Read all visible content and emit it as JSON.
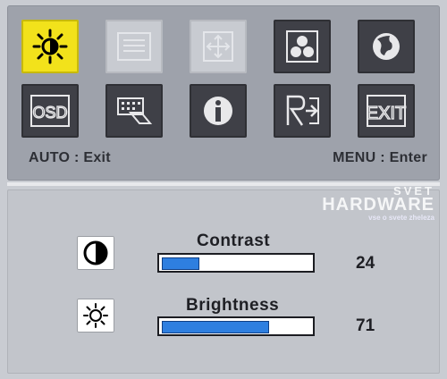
{
  "footer": {
    "left": "AUTO : Exit",
    "right": "MENU : Enter"
  },
  "menu_icons": [
    {
      "name": "brightness-icon",
      "state": "selected"
    },
    {
      "name": "text-list-icon",
      "state": "disabled"
    },
    {
      "name": "position-icon",
      "state": "disabled"
    },
    {
      "name": "color-circles-icon",
      "state": "normal"
    },
    {
      "name": "globe-language-icon",
      "state": "normal"
    },
    {
      "name": "osd-icon",
      "state": "normal"
    },
    {
      "name": "input-select-icon",
      "state": "normal"
    },
    {
      "name": "info-icon",
      "state": "normal"
    },
    {
      "name": "reset-icon",
      "state": "normal"
    },
    {
      "name": "exit-icon",
      "state": "normal"
    }
  ],
  "settings": {
    "contrast": {
      "label": "Contrast",
      "value": "24",
      "fraction": 0.24
    },
    "brightness": {
      "label": "Brightness",
      "value": "71",
      "fraction": 0.71
    }
  },
  "watermark": {
    "line1": "SVET",
    "line2": "HARDWARE",
    "line3": "vse o svete zheleza"
  },
  "colors": {
    "panel_top": "#9ea2ab",
    "panel_bottom": "#c2c5cb",
    "tile_dark": "#3f4047",
    "tile_selected": "#f2e21b",
    "bar_fill": "#2e7fe0"
  }
}
